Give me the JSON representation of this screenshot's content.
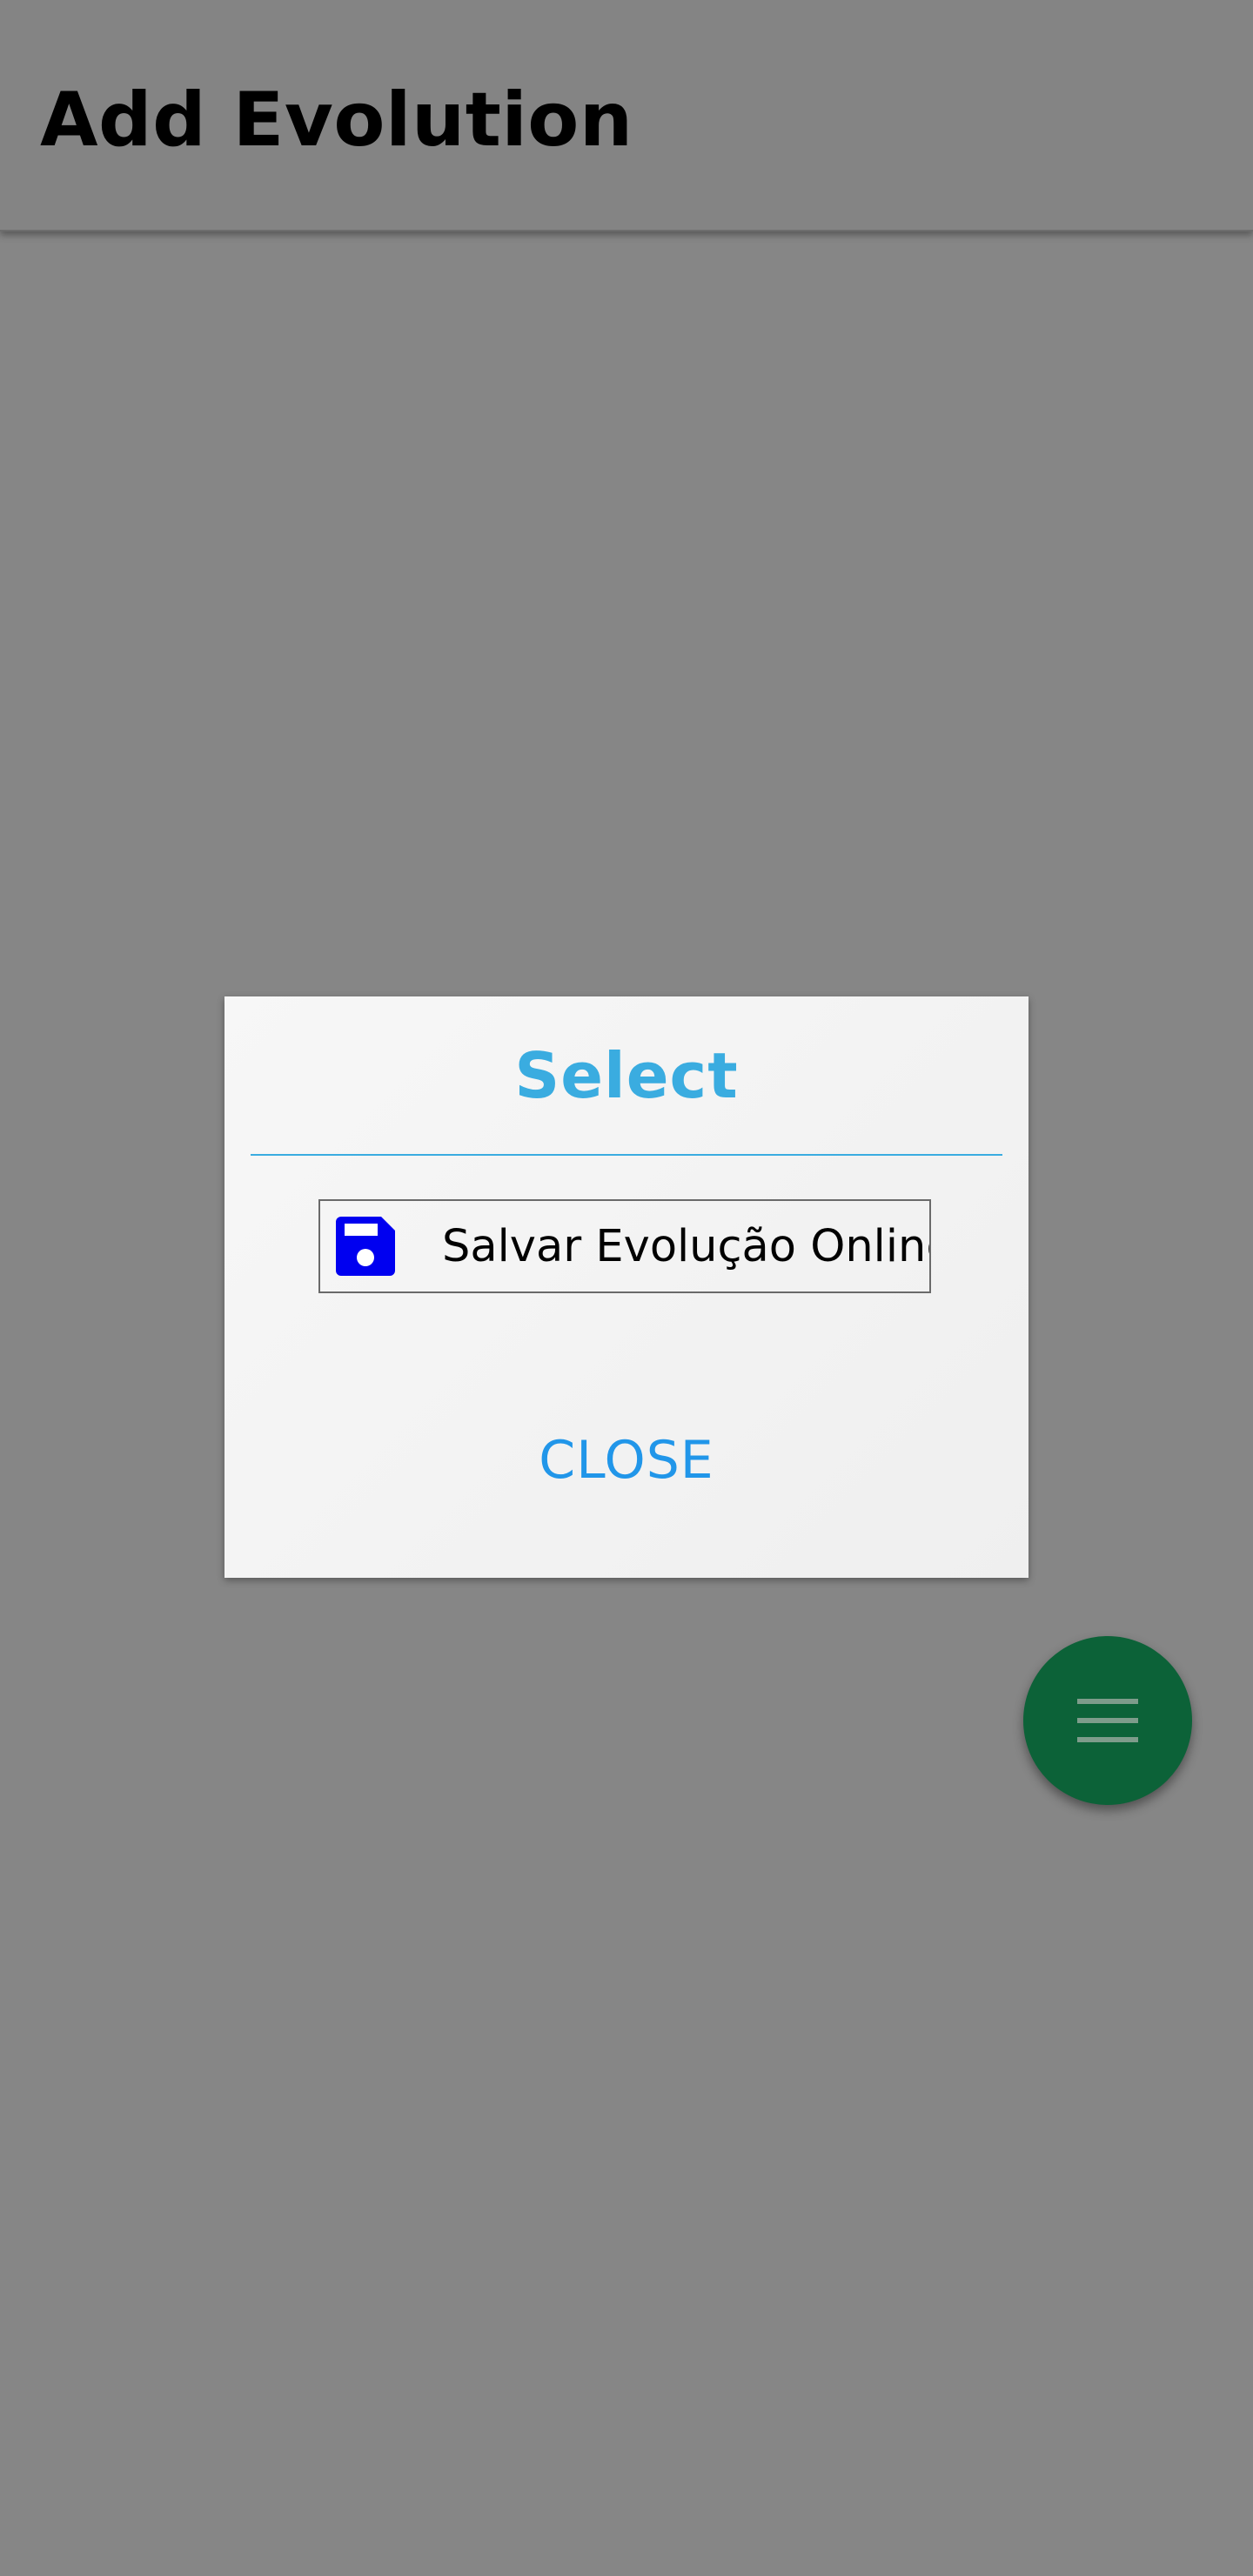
{
  "app_bar": {
    "title": "Add Evolution"
  },
  "dialog": {
    "title": "Select",
    "option": {
      "label": "Salvar Evolução Online",
      "icon": "floppy-disk-save-icon"
    },
    "close_label": "CLOSE"
  },
  "fab": {
    "icon": "menu-icon"
  },
  "colors": {
    "scrim": "#868686",
    "dialog_accent": "#3aace0",
    "close_text": "#2196e9",
    "save_icon": "#0000f0",
    "fab_background": "#0c6238"
  }
}
